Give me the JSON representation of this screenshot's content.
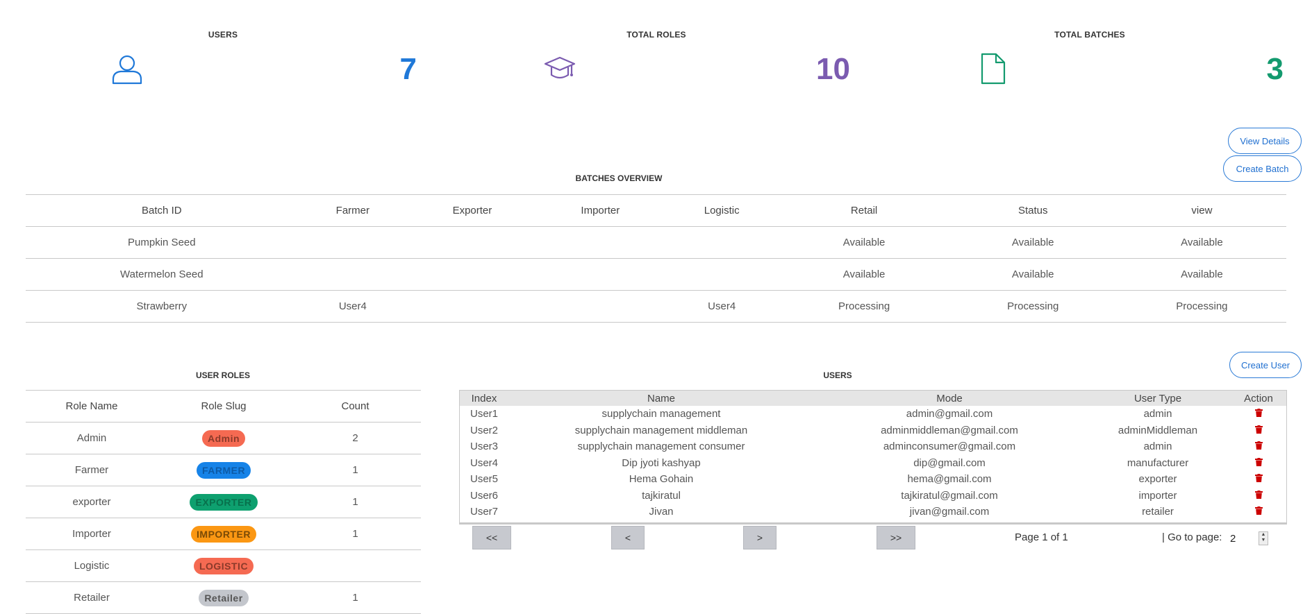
{
  "stats": [
    {
      "title": "USERS",
      "value": "7",
      "icon": "user-icon",
      "color": "#1f78d8"
    },
    {
      "title": "TOTAL ROLES",
      "value": "10",
      "icon": "graduation-cap-icon",
      "color": "#7b5bb0"
    },
    {
      "title": "TOTAL BATCHES",
      "value": "3",
      "icon": "document-icon",
      "color": "#139a6e"
    }
  ],
  "buttons": {
    "view_details": "View Details",
    "create_batch": "Create Batch",
    "create_user": "Create User"
  },
  "batches": {
    "title": "BATCHES OVERVIEW",
    "columns": [
      "Batch ID",
      "Farmer",
      "Exporter",
      "Importer",
      "Logistic",
      "Retail",
      "Status",
      "view"
    ],
    "rows": [
      [
        "Pumpkin Seed",
        "",
        "",
        "",
        "",
        "Available",
        "Available",
        "Available"
      ],
      [
        "Watermelon Seed",
        "",
        "",
        "",
        "",
        "Available",
        "Available",
        "Available"
      ],
      [
        "Strawberry",
        "User4",
        "",
        "",
        "User4",
        "Processing",
        "Processing",
        "Processing"
      ]
    ]
  },
  "roles": {
    "title": "USER ROLES",
    "columns": [
      "Role Name",
      "Role Slug",
      "Count"
    ],
    "rows": [
      {
        "name": "Admin",
        "slug": "Admin",
        "count": "2",
        "bg": "#f56a52",
        "fg": "#8a3a2a"
      },
      {
        "name": "Farmer",
        "slug": "FARMER",
        "count": "1",
        "bg": "#1683e8",
        "fg": "#0c5aa6"
      },
      {
        "name": "exporter",
        "slug": "EXPORTER",
        "count": "1",
        "bg": "#0ea06f",
        "fg": "#08704c"
      },
      {
        "name": "Importer",
        "slug": "IMPORTER",
        "count": "1",
        "bg": "#fb9713",
        "fg": "#7a4a06"
      },
      {
        "name": "Logistic",
        "slug": "LOGISTIC",
        "count": "",
        "bg": "#f56a52",
        "fg": "#8a3a2a"
      },
      {
        "name": "Retailer",
        "slug": "Retailer",
        "count": "1",
        "bg": "#c3c6cc",
        "fg": "#555555"
      }
    ]
  },
  "users": {
    "title": "USERS",
    "columns": [
      "Index",
      "Name",
      "Mode",
      "User Type",
      "Action"
    ],
    "rows": [
      [
        "User1",
        "supplychain management",
        "admin@gmail.com",
        "admin"
      ],
      [
        "User2",
        "supplychain management middleman",
        "adminmiddleman@gmail.com",
        "adminMiddleman"
      ],
      [
        "User3",
        "supplychain management consumer",
        "adminconsumer@gmail.com",
        "admin"
      ],
      [
        "User4",
        "Dip jyoti kashyap",
        "dip@gmail.com",
        "manufacturer"
      ],
      [
        "User5",
        "Hema Gohain",
        "hema@gmail.com",
        "exporter"
      ],
      [
        "User6",
        "tajkiratul",
        "tajkiratul@gmail.com",
        "importer"
      ],
      [
        "User7",
        "Jivan",
        "jivan@gmail.com",
        "retailer"
      ]
    ],
    "delete_icon": "trash-icon",
    "delete_color": "#cc0000"
  },
  "pagination": {
    "first": "<<",
    "prev": "<",
    "next": ">",
    "last": ">>",
    "page_info": "Page 1 of 1",
    "goto_label": "| Go to page:",
    "goto_value": "2"
  }
}
